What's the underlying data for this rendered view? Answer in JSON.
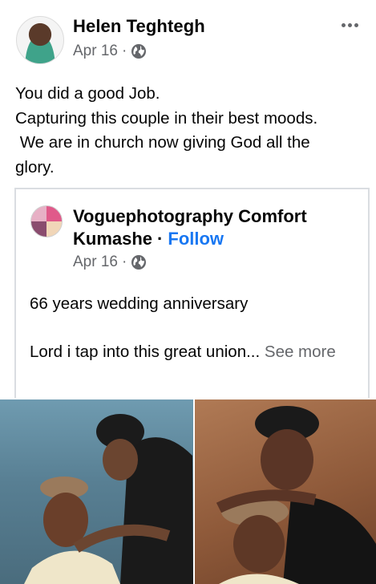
{
  "post": {
    "author": "Helen Teghtegh",
    "date": "Apr 16",
    "meta_separator": "·",
    "text_lines": [
      "You did a good Job.",
      "Capturing this couple in their best moods.",
      " We are in church now giving God all the",
      "glory."
    ]
  },
  "shared": {
    "author": "Voguephotography Comfort Kumashe",
    "follow_separator": "·",
    "follow_label": "Follow",
    "date": "Apr 16",
    "meta_separator": "·",
    "text_line1": "66 years wedding anniversary",
    "text_line2": "Lord i tap into this great union...",
    "see_more": "See more"
  },
  "icons": {
    "privacy": "globe-icon",
    "menu": "more-horizontal-icon"
  },
  "colors": {
    "primary_text": "#050505",
    "secondary_text": "#65676b",
    "link": "#1877f2",
    "card_border": "#dadde1"
  }
}
